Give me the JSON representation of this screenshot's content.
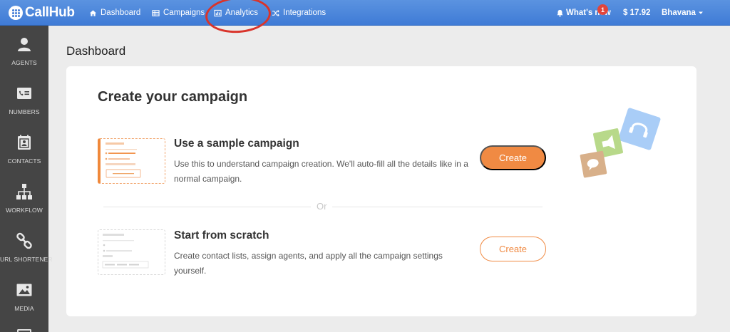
{
  "app": {
    "name": "CallHub"
  },
  "topnav": {
    "items": [
      {
        "label": "Dashboard",
        "icon": "home-icon"
      },
      {
        "label": "Campaigns",
        "icon": "table-icon"
      },
      {
        "label": "Analytics",
        "icon": "bar-chart-icon"
      },
      {
        "label": "Integrations",
        "icon": "shuffle-icon"
      }
    ],
    "whats_new": "What's new",
    "notification_count": "1",
    "balance": "$ 17.92",
    "user": "Bhavana"
  },
  "sidebar": {
    "items": [
      {
        "label": "AGENTS",
        "icon": "person-icon"
      },
      {
        "label": "NUMBERS",
        "icon": "phone-card-icon"
      },
      {
        "label": "CONTACTS",
        "icon": "contact-book-icon"
      },
      {
        "label": "WORKFLOW",
        "icon": "workflow-icon"
      },
      {
        "label": "URL SHORTENER",
        "icon": "link-icon"
      },
      {
        "label": "MEDIA",
        "icon": "image-icon"
      }
    ]
  },
  "page": {
    "title": "Dashboard"
  },
  "card": {
    "title": "Create your campaign",
    "options": [
      {
        "title": "Use a sample campaign",
        "description": "Use this to understand campaign creation. We'll auto-fill all the details like in a normal campaign.",
        "button": "Create"
      },
      {
        "title": "Start from scratch",
        "description": "Create contact lists, assign agents, and apply all the campaign settings yourself.",
        "button": "Create"
      }
    ],
    "separator": "Or"
  },
  "colors": {
    "topbar": "#4a86da",
    "sidebar": "#454545",
    "accent": "#f08a43",
    "annotation_circle": "#d9342b"
  }
}
